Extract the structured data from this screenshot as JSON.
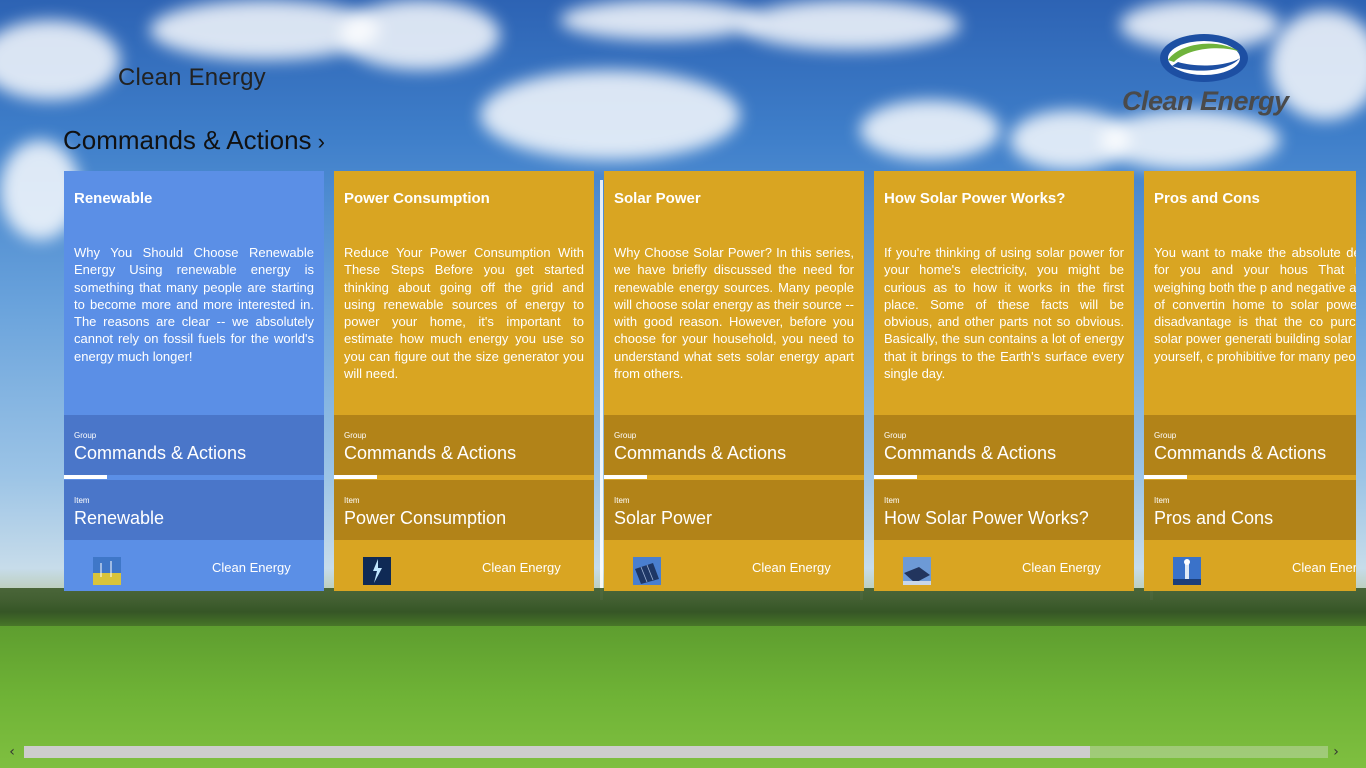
{
  "app": {
    "title": "Clean Energy"
  },
  "logo": {
    "text": "Clean Energy"
  },
  "section": {
    "title": "Commands & Actions",
    "chevron": "›"
  },
  "cards": [
    {
      "title": "Renewable",
      "body": "Why You Should Choose Renewable Energy Using renewable energy is something that many people are starting to become more and more interested in. The reasons are clear -- we absolutely cannot rely on fossil fuels for the world's energy much longer!",
      "group_label": "Group",
      "group_value": "Commands & Actions",
      "item_label": "Item",
      "item_value": "Renewable",
      "source": "Clean Energy",
      "thumb_icon": "wind-farm-thumbnail"
    },
    {
      "title": "Power Consumption",
      "body": "Reduce Your Power Consumption With These Steps Before you get started thinking about going off the grid and using renewable sources of energy to power your home, it's important to estimate how much energy you use so you can figure out the size generator you will need.",
      "group_label": "Group",
      "group_value": "Commands & Actions",
      "item_label": "Item",
      "item_value": "Power Consumption",
      "source": "Clean Energy",
      "thumb_icon": "lightning-thumbnail"
    },
    {
      "title": "Solar Power",
      "body": "Why Choose Solar Power? In this series, we have briefly discussed the need for renewable energy sources. Many people will choose solar energy as their source -- with good reason. However, before you choose for your household, you need to understand what sets solar energy apart from others.",
      "group_label": "Group",
      "group_value": "Commands & Actions",
      "item_label": "Item",
      "item_value": "Solar Power",
      "source": "Clean Energy",
      "thumb_icon": "solar-panel-thumbnail"
    },
    {
      "title": "How Solar Power Works?",
      "body": "If you're thinking of using solar power for your home's electricity, you might be curious as to how it works in the first place. Some of these facts will be obvious, and other parts not so obvious. Basically, the sun contains a lot of energy that it brings to the Earth's surface every single day.",
      "group_label": "Group",
      "group_value": "Commands & Actions",
      "item_label": "Item",
      "item_value": "How Solar Power Works?",
      "source": "Clean Energy",
      "thumb_icon": "solar-array-thumbnail"
    },
    {
      "title": "Pros and Cons",
      "body": "You want to make the absolute decision for you and your hous That means weighing both the p and negative aspects of convertin home to solar power. The disadvantage is that the co purchasing solar power generati building solar panels yourself, c prohibitive for many people.",
      "group_label": "Group",
      "group_value": "Commands & Actions",
      "item_label": "Item",
      "item_value": "Pros and Cons",
      "source": "Clean Ener",
      "thumb_icon": "tower-thumbnail"
    }
  ],
  "scrollbar": {
    "left_arrow": "‹",
    "right_arrow": "›"
  },
  "colors": {
    "blue_card": "#5b8fe6",
    "gold_card": "#d9a522"
  }
}
